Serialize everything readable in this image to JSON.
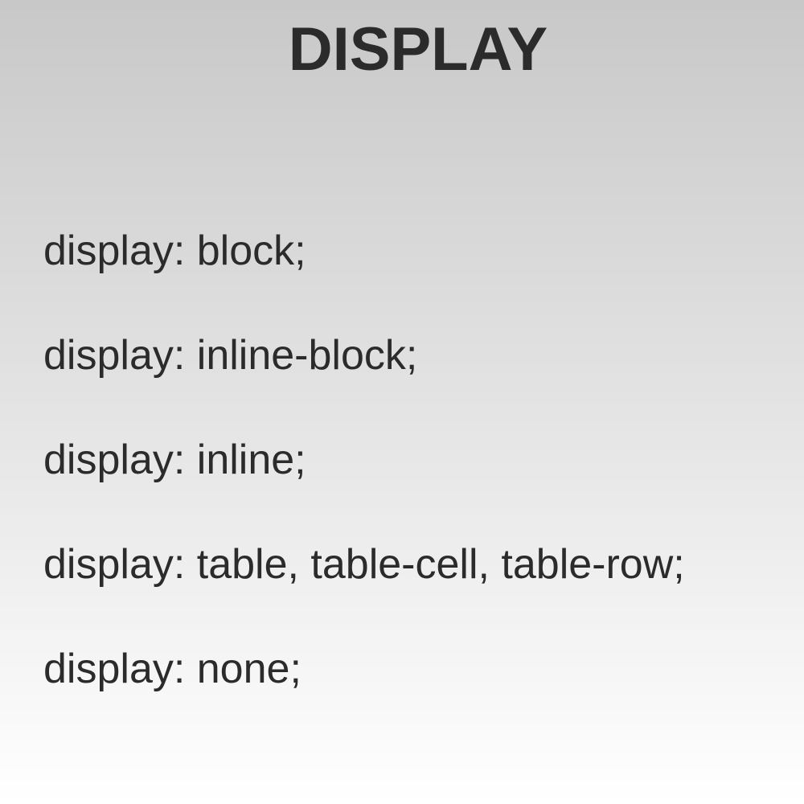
{
  "slide": {
    "title": "DISPLAY",
    "items": [
      "display: block;",
      "display: inline-block;",
      "display: inline;",
      "display: table, table-cell, table-row;",
      "display: none;"
    ]
  },
  "colors": {
    "text": "#2b2b2b",
    "background_top": "#c8c8c8",
    "background_bottom": "#ffffff"
  }
}
